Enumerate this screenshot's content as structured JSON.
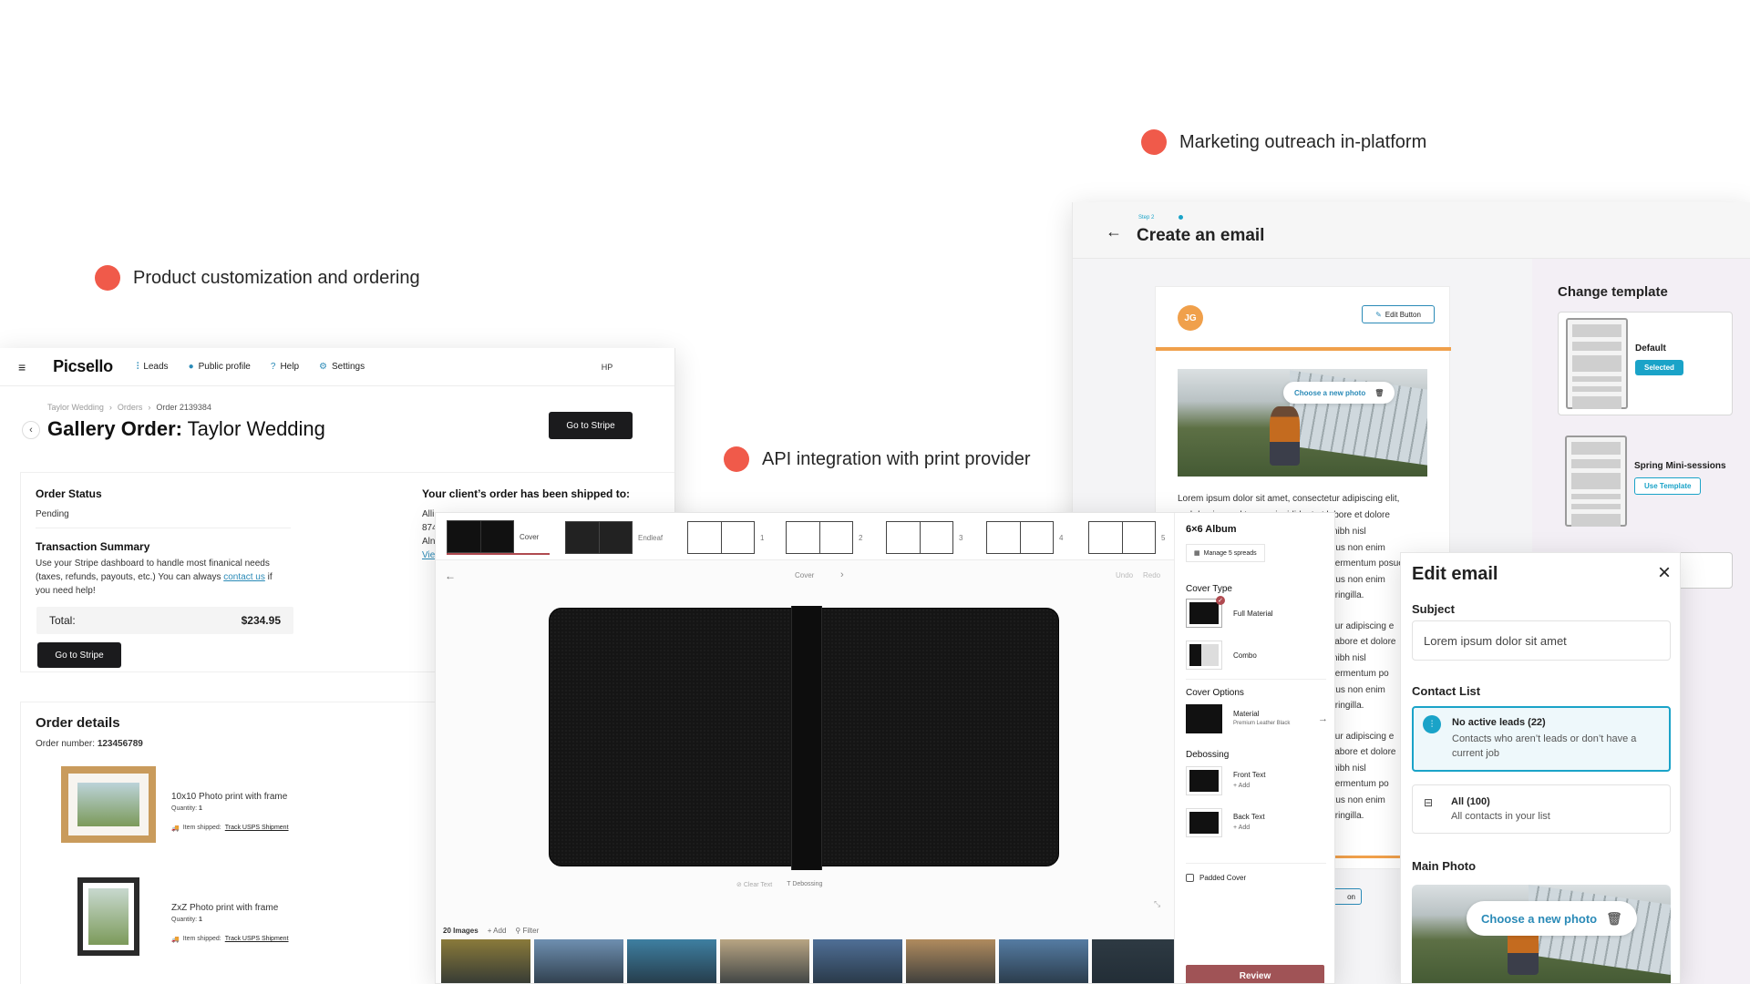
{
  "features": {
    "marketing": "Marketing outreach in-platform",
    "product": "Product customization and ordering",
    "api": "API integration with print provider"
  },
  "order": {
    "logo": "Picsello",
    "nav": [
      "Leads",
      "Public profile",
      "Help",
      "Settings"
    ],
    "user_initials": "HP",
    "breadcrumb": [
      "Taylor Wedding",
      "Orders",
      "Order 2139384"
    ],
    "title_bold": "Gallery Order:",
    "title_rest": " Taylor Wedding",
    "go_to_stripe": "Go to Stripe",
    "status_heading": "Order Status",
    "status_value": "Pending",
    "shipped_heading": "Your client’s order has been shipped to:",
    "shipped_lines": [
      "Alli",
      "874",
      "Aln"
    ],
    "shipped_link": "Vie",
    "summary_heading": "Transaction Summary",
    "summary_text": "Use your Stripe dashboard to handle most finanical needs (taxes, refunds, payouts, etc.) You can always",
    "summary_link": "contact us",
    "summary_tail": "if you need help!",
    "total_label": "Total:",
    "total_value": "$234.95",
    "details_heading": "Order details",
    "order_number_label": "Order number:",
    "order_number": "123456789",
    "items": [
      {
        "name": "10x10 Photo print with frame",
        "qty_label": "Quantity:",
        "qty": "1",
        "ship_label": "Item shipped:",
        "ship_link": "Track USPS Shipment"
      },
      {
        "name": "ZxZ Photo print with frame",
        "qty_label": "Quantity:",
        "qty": "1",
        "ship_label": "Item shipped:",
        "ship_link": "Track USPS Shipment"
      }
    ]
  },
  "album": {
    "spreads": [
      "Cover",
      "Endleaf",
      "1",
      "2",
      "3",
      "4",
      "5"
    ],
    "nav_center": "Cover",
    "undo": "Undo",
    "redo": "Redo",
    "tool_clear": "Clear Text",
    "tool_deboss": "Debossing",
    "images_count": "20 Images",
    "add": "Add",
    "filter": "Filter",
    "strip_colors": [
      "#8a7a3a",
      "#6e8fb0",
      "#3e7fa1",
      "#b8a583",
      "#4f6f96",
      "#b08b5e",
      "#557ca3",
      "#2e3a43",
      "#2f5b5f"
    ],
    "options": {
      "title": "6×6 Album",
      "manage": "Manage 5 spreads",
      "cover_type": "Cover Type",
      "full_material": "Full Material",
      "combo": "Combo",
      "cover_options": "Cover Options",
      "material": "Material",
      "material_value": "Premium Leather Black",
      "debossing": "Debossing",
      "front_text": "Front Text",
      "back_text": "Back Text",
      "add": "Add",
      "padded": "Padded Cover",
      "review": "Review"
    }
  },
  "email": {
    "step": "Step 2",
    "title": "Create an email",
    "avatar": "JG",
    "edit_button": "Edit Button",
    "choose_photo": "Choose a new photo",
    "body_lines": [
      "Lorem ipsum dolor sit amet, consectetur adipiscing elit,",
      "sed do eiusmod tempor incididunt ut labore et dolore"
    ],
    "partial_lines": [
      "nibh nisl",
      "rus non enim",
      "fermentum posuere",
      "rus non enim",
      "fringilla.",
      "tur adipiscing e",
      "labore et dolore",
      "nibh nisl",
      "fermentum po",
      "rus non enim",
      "fringilla.",
      "tur adipiscing e",
      "labore et dolore",
      "nibh nisl",
      "fermentum po",
      "rus non enim",
      "fringilla."
    ],
    "partial_btn": "on",
    "template_heading": "Change template",
    "templates": [
      {
        "name": "Default",
        "action": "Selected"
      },
      {
        "name": "Spring Mini-sessions",
        "action": "Use Template"
      }
    ]
  },
  "edit_email": {
    "title": "Edit email",
    "subject_label": "Subject",
    "subject_value": "Lorem ipsum dolor sit amet",
    "contact_label": "Contact List",
    "contacts": [
      {
        "title": "No active leads (22)",
        "desc": "Contacts who aren’t leads or don’t have a current job"
      },
      {
        "title": "All (100)",
        "desc": "All contacts in your list"
      }
    ],
    "main_photo_label": "Main Photo",
    "choose_photo": "Choose a new photo"
  },
  "colors": {
    "accent_dot": "#f05a4a",
    "link_blue": "#2a8ab7",
    "review_red": "#a05356",
    "email_orange": "#f0a04b",
    "selected_teal": "#1aa3c8"
  }
}
